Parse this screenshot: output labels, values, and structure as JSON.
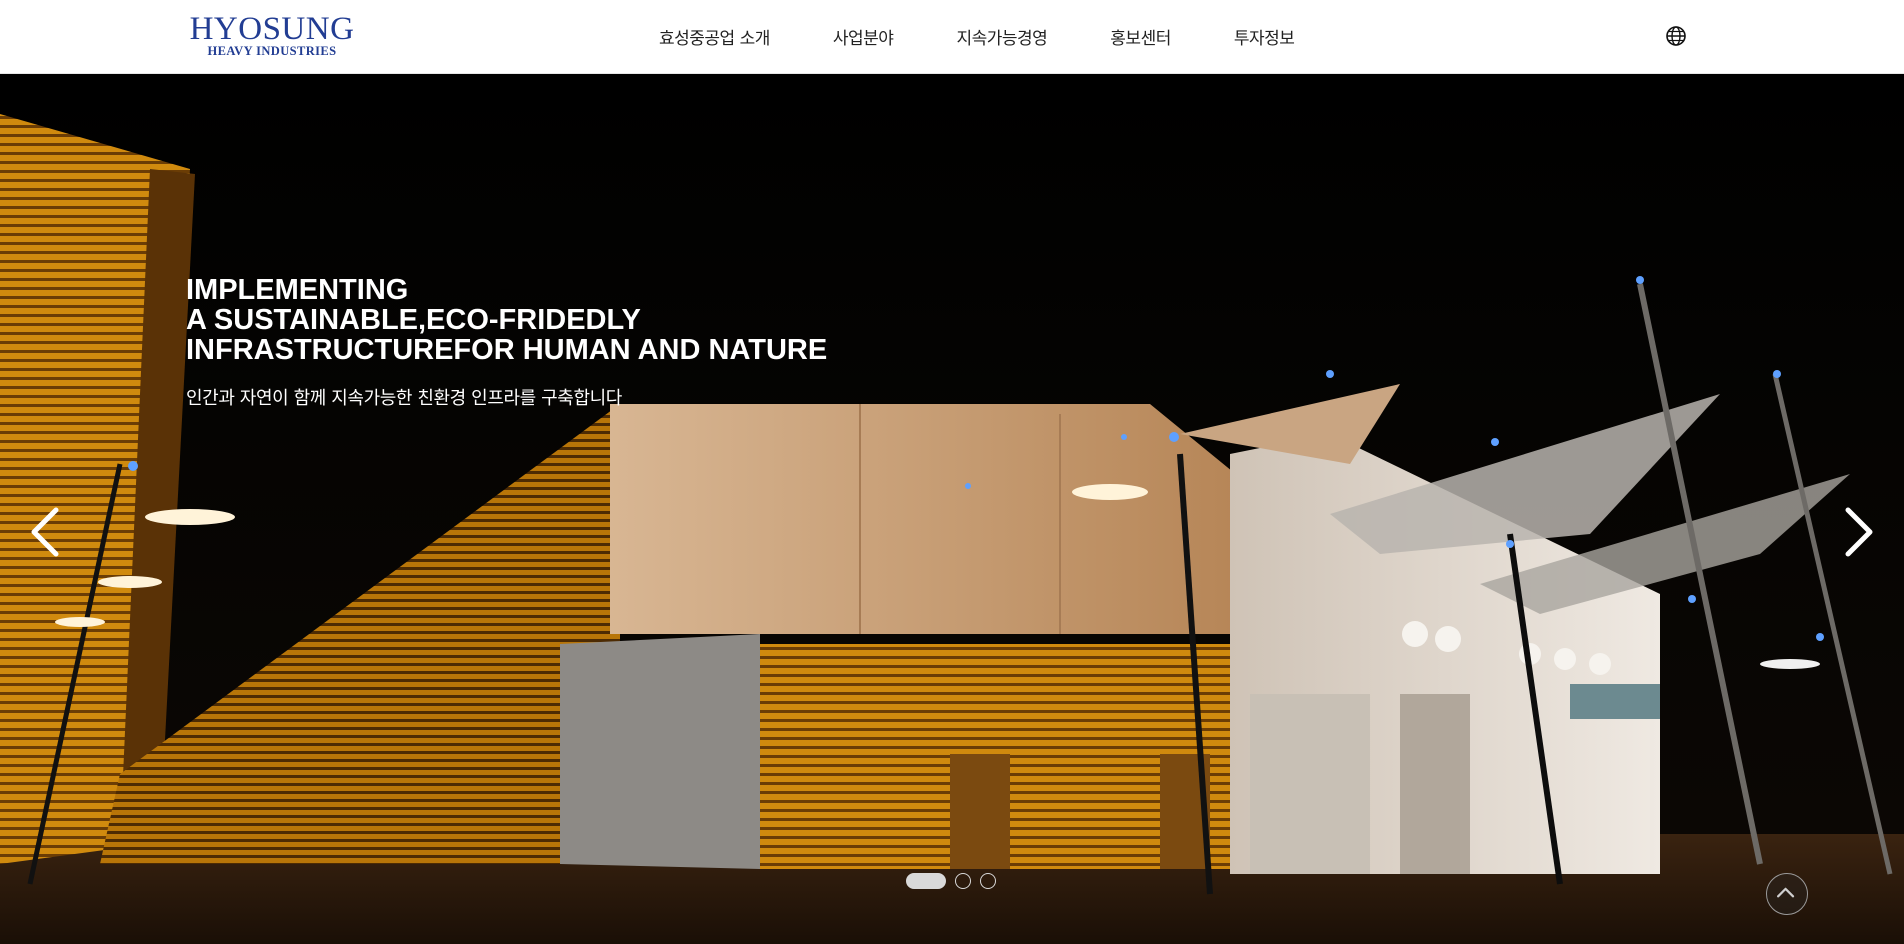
{
  "header": {
    "logo": {
      "main": "HYOSUNG",
      "sub": "HEAVY INDUSTRIES",
      "color": "#223d93"
    },
    "nav": [
      {
        "label": "효성중공업 소개"
      },
      {
        "label": "사업분야"
      },
      {
        "label": "지속가능경영"
      },
      {
        "label": "홍보센터"
      },
      {
        "label": "투자정보"
      }
    ],
    "language_icon": "globe-icon"
  },
  "hero": {
    "headline": [
      "IMPLEMENTING",
      "A SUSTAINABLE,ECO-FRIDEDLY",
      "INFRASTRUCTUREFOR HUMAN AND NATURE"
    ],
    "subheadline": "인간과 자연이 함께 지속가능한 친환경 인프라를 구축합니다",
    "prev_icon": "chevron-left-icon",
    "next_icon": "chevron-right-icon",
    "slides_total": 3,
    "active_slide": 1,
    "scroll_top_icon": "chevron-up-icon"
  }
}
